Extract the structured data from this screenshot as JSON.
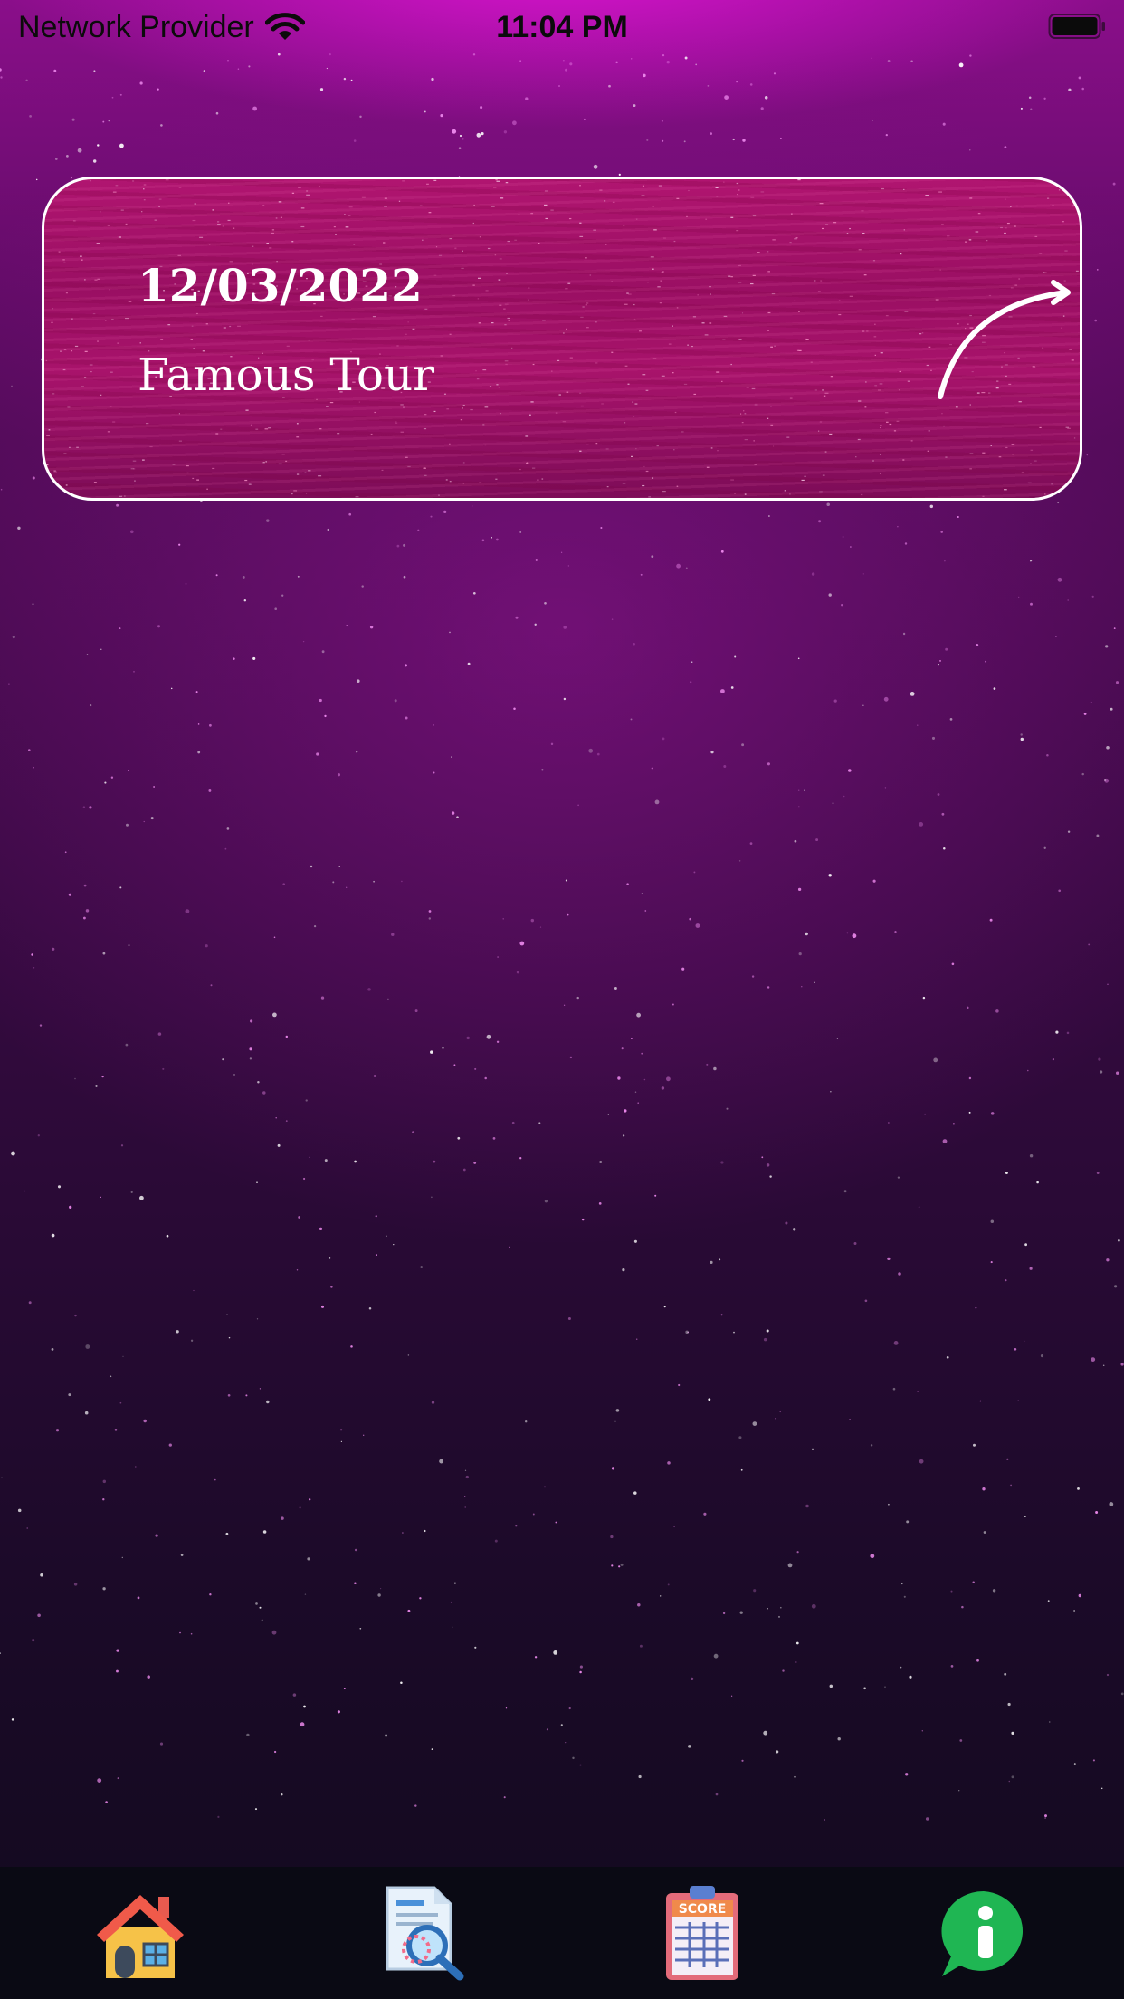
{
  "status_bar": {
    "carrier": "Network Provider",
    "time": "11:04 PM",
    "wifi_icon": "wifi-icon",
    "battery_icon": "battery-icon"
  },
  "event_card": {
    "date": "12/03/2022",
    "title": "Famous Tour",
    "arrow_icon": "curved-arrow-icon",
    "border_color": "#ffffff"
  },
  "tab_bar": {
    "tabs": [
      {
        "icon": "home-icon"
      },
      {
        "icon": "document-search-icon"
      },
      {
        "icon": "scoreboard-icon",
        "icon_text": "SCORE"
      },
      {
        "icon": "info-chat-icon"
      }
    ]
  },
  "colors": {
    "background_top": "#8a0e8a",
    "background_bottom": "#120a1e",
    "tab_bar": "#0a0a14",
    "info_green": "#1fb653"
  }
}
